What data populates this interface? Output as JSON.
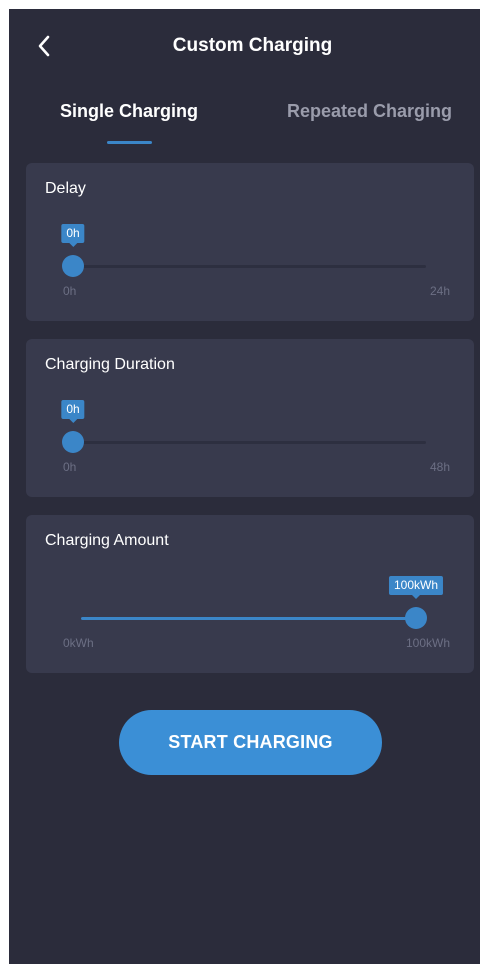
{
  "header": {
    "title": "Custom Charging",
    "back_icon": "chevron-left-icon"
  },
  "tabs": [
    {
      "label": "Single Charging",
      "active": true
    },
    {
      "label": "Repeated Charging",
      "active": false
    }
  ],
  "sliders": {
    "delay": {
      "label": "Delay",
      "value_label": "0h",
      "min_label": "0h",
      "max_label": "24h",
      "value_fraction": 0
    },
    "duration": {
      "label": "Charging Duration",
      "value_label": "0h",
      "min_label": "0h",
      "max_label": "48h",
      "value_fraction": 0
    },
    "amount": {
      "label": "Charging Amount",
      "value_label": "100kWh",
      "min_label": "0kWh",
      "max_label": "100kWh",
      "value_fraction": 1
    }
  },
  "start_button": {
    "label": "START CHARGING"
  },
  "colors": {
    "background": "#2b2c3b",
    "card": "#383a4d",
    "accent": "#3b86c8",
    "muted_text": "#6c6f84"
  }
}
